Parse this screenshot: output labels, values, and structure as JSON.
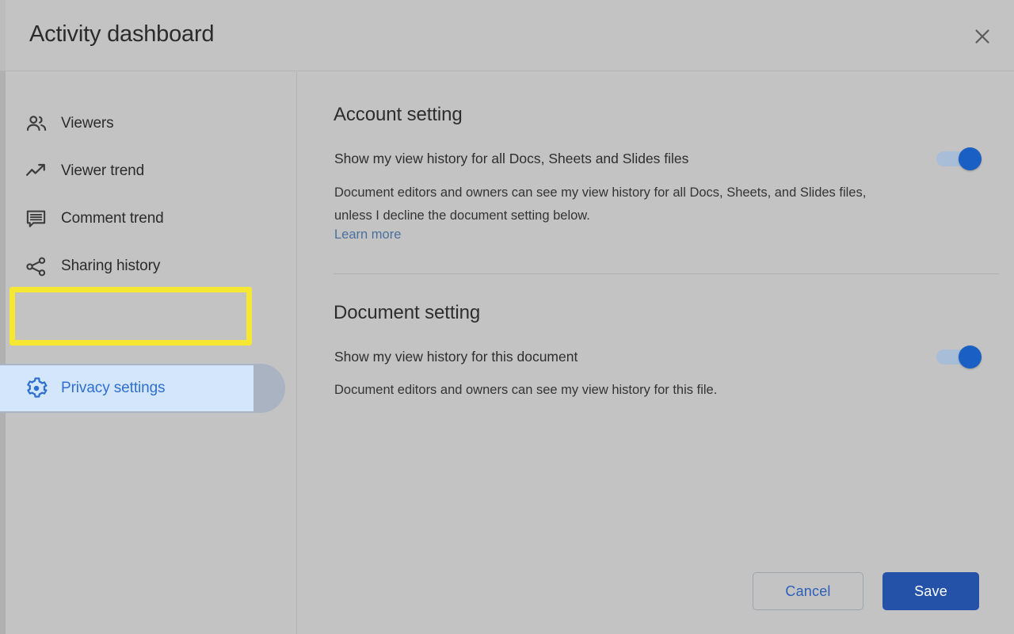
{
  "window": {
    "title": "Activity dashboard",
    "close_icon": "close-icon"
  },
  "sidebar": {
    "items": [
      {
        "label": "Viewers",
        "icon": "people-icon",
        "selected": false
      },
      {
        "label": "Viewer trend",
        "icon": "trending-up-icon",
        "selected": false
      },
      {
        "label": "Comment trend",
        "icon": "comment-icon",
        "selected": false
      },
      {
        "label": "Sharing history",
        "icon": "share-icon",
        "selected": false
      },
      {
        "label": "Privacy settings",
        "icon": "gear-icon",
        "selected": true
      }
    ]
  },
  "main": {
    "account_section": {
      "title": "Account setting",
      "toggle_label": "Show my view history for all Docs, Sheets and Slides files",
      "description": "Document editors and owners can see my view history for all Docs, Sheets, and Slides files, unless I decline the document setting below.",
      "learn_more": "Learn more",
      "toggle_state": "on"
    },
    "document_section": {
      "title": "Document setting",
      "toggle_label": "Show my view history for this document",
      "description": "Document editors and owners can see my view history for this file.",
      "toggle_state": "on"
    }
  },
  "footer": {
    "cancel_label": "Cancel",
    "save_label": "Save"
  },
  "colors": {
    "background": "#c3c3c3",
    "accent_blue": "#2352a8",
    "link_blue": "#4b6f9e",
    "selected_bg": "#d3e6fb",
    "selected_text": "#2f6fd0",
    "annotation_yellow": "#f6e733",
    "toggle_knob": "#1a5fc4",
    "toggle_track": "#a8bdd8"
  }
}
